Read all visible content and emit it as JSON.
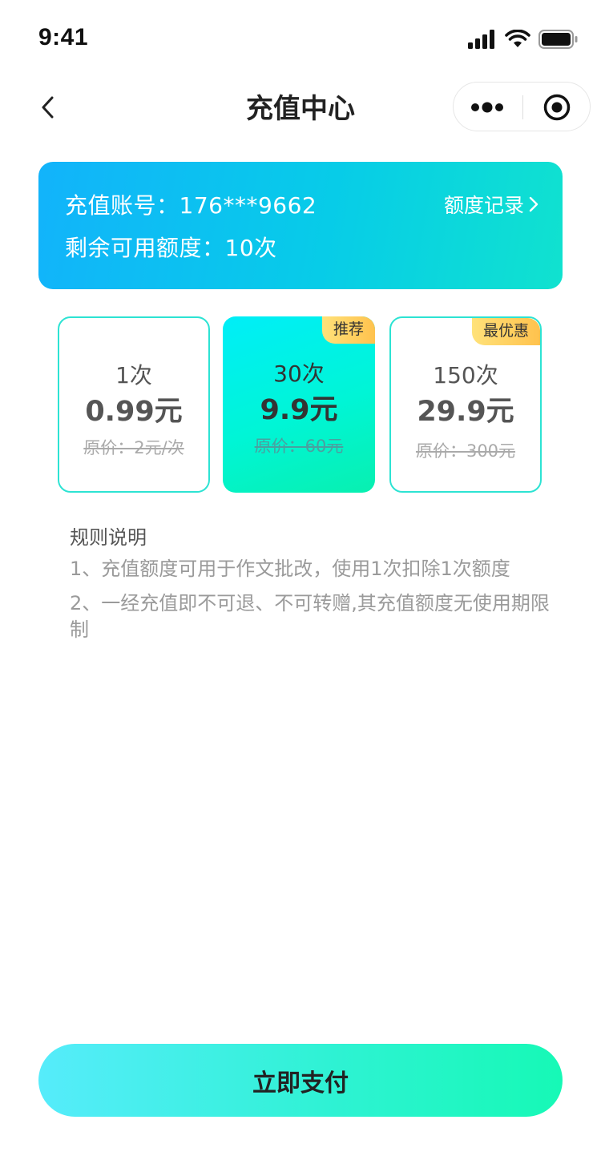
{
  "status_bar": {
    "time": "9:41"
  },
  "nav": {
    "title": "充值中心"
  },
  "account": {
    "number_line": "充值账号：176***9662",
    "quota_line": "剩余可用额度：10次",
    "record_link": "额度记录"
  },
  "packages": [
    {
      "count": "1次",
      "price": "0.99元",
      "original": "原价：2元/次",
      "badge": "",
      "selected": false
    },
    {
      "count": "30次",
      "price": "9.9元",
      "original": "原价：60元",
      "badge": "推荐",
      "selected": true
    },
    {
      "count": "150次",
      "price": "29.9元",
      "original": "原价：300元",
      "badge": "最优惠",
      "selected": false
    }
  ],
  "rules": {
    "title": "规则说明",
    "items": [
      "1、充值额度可用于作文批改，使用1次扣除1次额度",
      "2、一经充值即不可退、不可转赠,其充值额度无使用期限制"
    ]
  },
  "pay_button": {
    "label": "立即支付"
  },
  "icons": {
    "back": "chevron-left-icon",
    "more": "more-dots-icon",
    "target": "target-icon",
    "signal": "signal-icon",
    "wifi": "wifi-icon",
    "battery": "battery-icon"
  },
  "colors": {
    "card_gradient_start": "#12b3fb",
    "card_gradient_end": "#10e2cf",
    "package_border": "#2de3d3",
    "badge": "#ffc24d",
    "pay_gradient_start": "#56ecfb",
    "pay_gradient_end": "#16f9b6"
  }
}
